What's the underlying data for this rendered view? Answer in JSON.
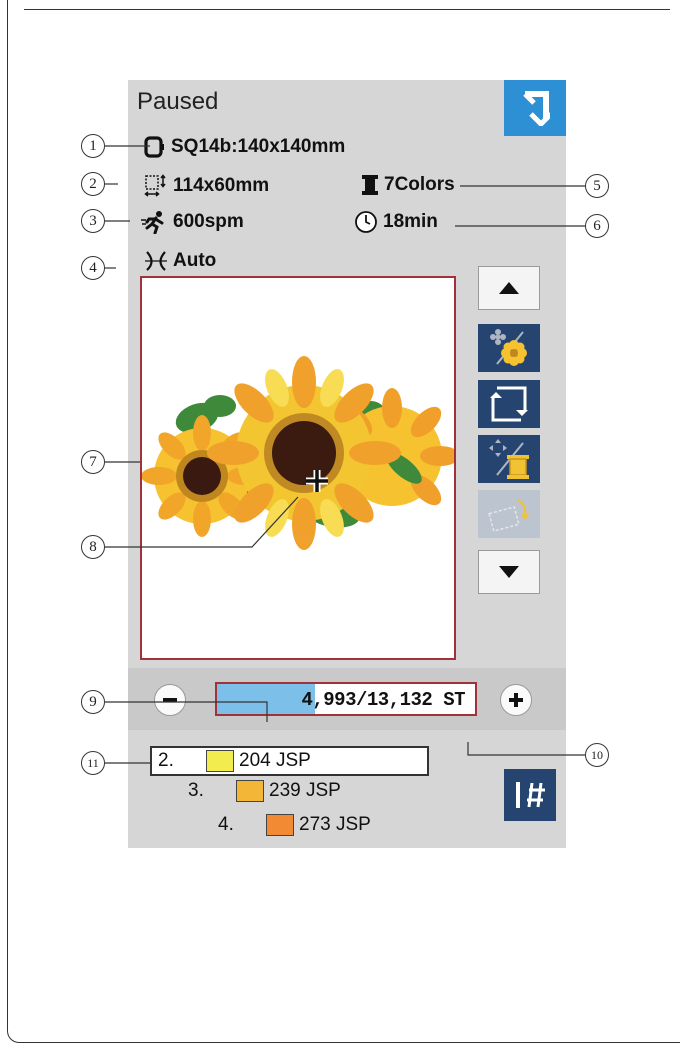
{
  "status": {
    "title": "Paused"
  },
  "info": {
    "hoop": "SQ14b:140x140mm",
    "design_size": "114x60mm",
    "colors": "7Colors",
    "speed": "600spm",
    "time": "18min",
    "trim": "Auto"
  },
  "stitch_count": {
    "text": "4,993/13,132 ST",
    "current": 4993,
    "total": 13132
  },
  "color_list": [
    {
      "index": "2.",
      "code": "204 JSP",
      "color": "#f3ec4e",
      "current": true
    },
    {
      "index": "3.",
      "code": "239 JSP",
      "color": "#f3b637",
      "current": false
    },
    {
      "index": "4.",
      "code": "273 JSP",
      "color": "#f28a34",
      "current": false
    }
  ],
  "callouts": [
    "1",
    "2",
    "3",
    "4",
    "5",
    "6",
    "7",
    "8",
    "9",
    "10",
    "11"
  ],
  "icons": {
    "back": "back-arrow-icon",
    "hoop": "hoop-icon",
    "size": "design-size-icon",
    "colors": "thread-spool-icon",
    "speed": "running-man-icon",
    "time": "clock-icon",
    "trim": "thread-trim-icon",
    "up": "scroll-up-icon",
    "down": "scroll-down-icon",
    "jump": "jump-stitch-icon"
  },
  "accent_colors": {
    "back_button": "#2d8fd4",
    "button_dark": "#254570",
    "frame": "#a3313a",
    "progress": "#7cc0ea"
  }
}
